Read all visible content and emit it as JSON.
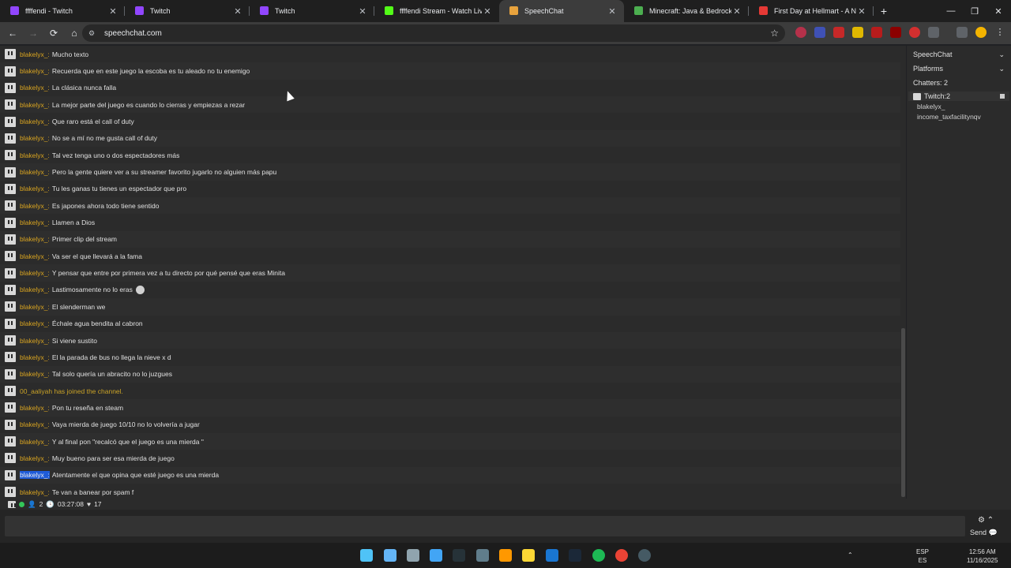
{
  "tabs": [
    {
      "title": "ffffendi - Twitch",
      "color": "#9146ff"
    },
    {
      "title": "Twitch",
      "color": "#9146ff"
    },
    {
      "title": "Twitch",
      "color": "#9146ff"
    },
    {
      "title": "ffffendi Stream - Watch Live on",
      "color": "#53fc18"
    },
    {
      "title": "SpeechChat",
      "color": "#e8a33d",
      "active": true
    },
    {
      "title": "Minecraft: Java & Bedrock Editi",
      "color": "#4caf50"
    },
    {
      "title": "First Day at Hellmart - A Night",
      "color": "#e53935"
    }
  ],
  "window": {
    "minimize": "—",
    "maximize": "❐",
    "close": "✕",
    "new_tab": "+"
  },
  "toolbar": {
    "back": "←",
    "forward": "→",
    "reload": "⟳",
    "home": "⌂",
    "url": "speechchat.com",
    "star": "☆"
  },
  "messages": [
    {
      "user": "blakelyx_:",
      "text": "Mucho texto"
    },
    {
      "user": "blakelyx_:",
      "text": "Recuerda que en este juego la escoba es tu aleado no tu enemigo"
    },
    {
      "user": "blakelyx_:",
      "text": "La clásica nunca falla"
    },
    {
      "user": "blakelyx_:",
      "text": "La mejor parte del juego es cuando lo cierras y empiezas a rezar"
    },
    {
      "user": "blakelyx_:",
      "text": "Que raro está el call of duty"
    },
    {
      "user": "blakelyx_:",
      "text": "No se a mí no me gusta call of duty"
    },
    {
      "user": "blakelyx_:",
      "text": "Tal vez tenga uno o dos espectadores más"
    },
    {
      "user": "blakelyx_:",
      "text": "Pero la gente quiere ver a su streamer favorito jugarlo no alguien más papu"
    },
    {
      "user": "blakelyx_:",
      "text": "Tu les ganas tu tienes un espectador que pro"
    },
    {
      "user": "blakelyx_:",
      "text": "Es japones ahora todo tiene sentido"
    },
    {
      "user": "blakelyx_:",
      "text": "Llamen a Dios"
    },
    {
      "user": "blakelyx_:",
      "text": "Primer clip del stream"
    },
    {
      "user": "blakelyx_:",
      "text": "Va ser el que llevará a la fama"
    },
    {
      "user": "blakelyx_:",
      "text": "Y pensar que entre por primera vez a tu directo por qué pensé que eras Minita"
    },
    {
      "user": "blakelyx_:",
      "text": "Lastimosamente no lo eras",
      "emote": true
    },
    {
      "user": "blakelyx_:",
      "text": "El slenderman we"
    },
    {
      "user": "blakelyx_:",
      "text": "Échale agua bendita al cabron"
    },
    {
      "user": "blakelyx_:",
      "text": "Si viene sustito"
    },
    {
      "user": "blakelyx_:",
      "text": "El la parada de bus no llega la nieve x d"
    },
    {
      "user": "blakelyx_:",
      "text": "Tal solo quería un abracito no lo juzgues"
    },
    {
      "system": "00_aaliyah has joined the channel."
    },
    {
      "user": "blakelyx_:",
      "text": "Pon tu reseña en steam"
    },
    {
      "user": "blakelyx_:",
      "text": "Vaya mierda de juego 10/10 no lo volvería a jugar"
    },
    {
      "user": "blakelyx_:",
      "text": "Y al final pon \"recalcó que el juego es una mierda \""
    },
    {
      "user": "blakelyx_:",
      "text": "Muy bueno para ser esa mierda de juego"
    },
    {
      "user": "blakelyx_:",
      "text": "Atentamente el que opina que esté juego es una mierda",
      "selected": true
    },
    {
      "user": "blakelyx_:",
      "text": "Te van a banear por spam f"
    }
  ],
  "panel": {
    "speechchat": "SpeechChat",
    "platforms": "Platforms",
    "chatters": "Chatters: 2",
    "platform_name": "Twitch:2",
    "chatter_list": [
      "blakelyx_",
      "income_taxfacilitynqv"
    ]
  },
  "status": {
    "viewers": "2",
    "uptime": "03:27:08",
    "likes": "17"
  },
  "input": {
    "send": "Send"
  },
  "tray": {
    "lang": "ESP",
    "lang2": "ES",
    "time": "12:56 AM",
    "date": "11/16/2025"
  }
}
